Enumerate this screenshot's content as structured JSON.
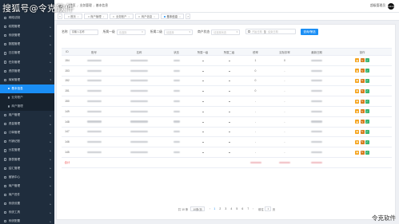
{
  "watermark": {
    "top_left": "搜狐号@令克软件",
    "bottom_right": "令克软件"
  },
  "sidebar": {
    "items": [
      {
        "label": "网络法制",
        "caret": ""
      },
      {
        "label": "权限管理",
        "caret": "▸"
      },
      {
        "label": "系统管理",
        "caret": "▸"
      },
      {
        "label": "数据管理",
        "caret": "▸"
      },
      {
        "label": "日志管理",
        "caret": "▸"
      },
      {
        "label": "任务管理",
        "caret": "▸"
      },
      {
        "label": "资质管理",
        "caret": "▸"
      },
      {
        "label": "商家管理",
        "caret": "▾"
      }
    ],
    "submenu": [
      {
        "label": "基本信息",
        "active": true
      },
      {
        "label": "业务账户",
        "active": false
      },
      {
        "label": "商户管理",
        "active": false
      }
    ],
    "items_after": [
      {
        "label": "用户管理",
        "caret": "▸"
      },
      {
        "label": "资金管理",
        "caret": "▸"
      },
      {
        "label": "订单管理",
        "caret": "▸"
      },
      {
        "label": "代销记账",
        "caret": "▸"
      },
      {
        "label": "分发管理",
        "caret": "▸"
      },
      {
        "label": "报表管理",
        "caret": "▸"
      },
      {
        "label": "结汇管理",
        "caret": "▸"
      },
      {
        "label": "营销中心",
        "caret": "▸"
      },
      {
        "label": "商户管理",
        "caret": "▸"
      },
      {
        "label": "商户进件",
        "caret": "▸"
      },
      {
        "label": "系统设置",
        "caret": "▸"
      },
      {
        "label": "系统工具",
        "caret": "▸"
      },
      {
        "label": "系统配置",
        "caret": "▸"
      }
    ]
  },
  "header": {
    "breadcrumb": [
      "首页",
      "业务管理",
      "基本信息"
    ],
    "home_glyph": "⌂",
    "separator": "/",
    "user_name": "超级管理员",
    "avatar_text": "Admin"
  },
  "tabs": {
    "prev": "«",
    "next": "»",
    "items": [
      {
        "label": "首页",
        "active": false
      },
      {
        "label": "商户管理",
        "active": false
      },
      {
        "label": "业务账户",
        "active": false
      },
      {
        "label": "商户信息",
        "active": false
      },
      {
        "label": "基本信息",
        "active": true
      }
    ],
    "close_glyph": "×"
  },
  "filter": {
    "label_1": "名称",
    "input_1_placeholder": "请输入名称",
    "label_2": "所属一级",
    "select_2_value": "请选择",
    "label_3": "所属二级",
    "select_3_value": "请选择",
    "label_4": "商户状态",
    "select_4_value": "请选择状态",
    "date_start": "开始日期",
    "date_mid": "至",
    "date_end": "结束日期",
    "search_button": "查询/筛选"
  },
  "table": {
    "headers": [
      "ID",
      "账号",
      "名称",
      "状态",
      "所属一级",
      "所属二级",
      "税率",
      "实际扣率",
      "最新日期",
      "操作"
    ],
    "rows": [
      {
        "id": "154",
        "rate": "1",
        "actual": "0"
      },
      {
        "id": "153",
        "rate": "0",
        "actual": "-"
      },
      {
        "id": "152",
        "rate": "0",
        "actual": "-"
      },
      {
        "id": "151",
        "rate": "0",
        "actual": "-"
      },
      {
        "id": "150",
        "rate": "-",
        "actual": "-"
      },
      {
        "id": "149",
        "rate": "-",
        "actual": "-"
      },
      {
        "id": "148",
        "rate": "-",
        "actual": "-"
      },
      {
        "id": "147",
        "rate": "-",
        "actual": "-"
      },
      {
        "id": "146",
        "rate": "-",
        "actual": "-"
      },
      {
        "id": "145",
        "rate": "-",
        "actual": "-"
      }
    ],
    "summary_label": "合计",
    "ops": {
      "view": "◉",
      "edit": "✎",
      "ok": "✓"
    }
  },
  "pagination": {
    "total": "共 10 条",
    "page_size": "10条/页",
    "prev": "‹",
    "next": "›",
    "pages": [
      "1",
      "2",
      "3",
      "4",
      "5",
      "6",
      "7"
    ],
    "current": "1",
    "goto_label": "前往",
    "goto_value": "1",
    "goto_suffix": "页"
  },
  "colors": {
    "sidebar_bg": "#1f2d3d",
    "accent": "#1a8ef5",
    "view_btn": "#f5a623",
    "edit_btn": "#d77c1f",
    "ok_btn": "#3cb371"
  }
}
